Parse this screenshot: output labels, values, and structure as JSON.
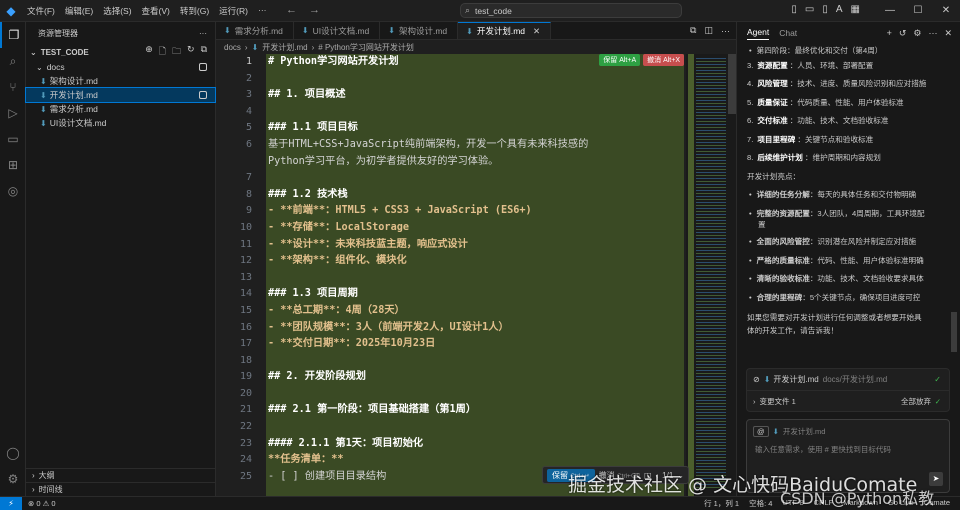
{
  "menu": [
    "文件(F)",
    "编辑(E)",
    "选择(S)",
    "查看(V)",
    "转到(G)",
    "运行(R)"
  ],
  "search": {
    "value": "test_code"
  },
  "sidebar": {
    "title": "资源管理器",
    "root": "TEST_CODE",
    "folder": "docs",
    "files": [
      "架构设计.md",
      "开发计划.md",
      "需求分析.md",
      "UI设计文档.md"
    ],
    "bottom": [
      "大纲",
      "时间线"
    ]
  },
  "tabs": [
    "需求分析.md",
    "UI设计文档.md",
    "架构设计.md",
    "开发计划.md"
  ],
  "breadcrumb": [
    "docs",
    "开发计划.md",
    "# Python学习网站开发计划"
  ],
  "keep_buttons": {
    "keep": "保留 Alt+A",
    "undo": "撤消 Alt+X"
  },
  "editor": {
    "line_numbers": [
      "1",
      "2",
      "3",
      "4",
      "5",
      "6",
      "",
      "7",
      "8",
      "9",
      "10",
      "11",
      "12",
      "13",
      "14",
      "15",
      "16",
      "17",
      "18",
      "19",
      "20",
      "21",
      "22",
      "23",
      "24",
      "25"
    ],
    "lines": [
      {
        "t": "# Python学习网站开发计划",
        "k": "h"
      },
      {
        "t": "",
        "k": "t"
      },
      {
        "t": "## 1. 项目概述",
        "k": "h"
      },
      {
        "t": "",
        "k": "t"
      },
      {
        "t": "### 1.1 项目目标",
        "k": "h"
      },
      {
        "t": "基于HTML+CSS+JavaScript纯前端架构，开发一个具有未来科技感的",
        "k": "t"
      },
      {
        "t": "Python学习平台，为初学者提供友好的学习体验。",
        "k": "t"
      },
      {
        "t": "",
        "k": "t"
      },
      {
        "t": "### 1.2 技术栈",
        "k": "h"
      },
      {
        "t": "- **前端**：HTML5 + CSS3 + JavaScript (ES6+)",
        "k": "b"
      },
      {
        "t": "- **存储**：LocalStorage",
        "k": "b"
      },
      {
        "t": "- **设计**：未来科技蓝主题，响应式设计",
        "k": "b"
      },
      {
        "t": "- **架构**：组件化、模块化",
        "k": "b"
      },
      {
        "t": "",
        "k": "t"
      },
      {
        "t": "### 1.3 项目周期",
        "k": "h"
      },
      {
        "t": "- **总工期**：4周（28天）",
        "k": "b"
      },
      {
        "t": "- **团队规模**：3人（前端开发2人，UI设计1人）",
        "k": "b"
      },
      {
        "t": "- **交付日期**：2025年10月23日",
        "k": "b"
      },
      {
        "t": "",
        "k": "t"
      },
      {
        "t": "## 2. 开发阶段规划",
        "k": "h"
      },
      {
        "t": "",
        "k": "t"
      },
      {
        "t": "### 2.1 第一阶段：项目基础搭建（第1周）",
        "k": "h"
      },
      {
        "t": "",
        "k": "t"
      },
      {
        "t": "#### 2.1.1 第1天：项目初始化",
        "k": "h"
      },
      {
        "t": "**任务清单：**",
        "k": "b"
      },
      {
        "t": "- [ ] 创建项目目录结构",
        "k": "t"
      }
    ]
  },
  "diffbar": {
    "keep": "保留",
    "keep_hint": "Ctrl+↵",
    "undo": "撤消",
    "undo_hint": "Ctrl+⌫",
    "page": "1/1"
  },
  "chat": {
    "tabs": [
      "Agent",
      "Chat"
    ],
    "top_sub": "第四阶段：最终优化和交付（第4周）",
    "numbered": [
      {
        "n": "3.",
        "b": "资源配置",
        "r": "：人员、环境、部署配置"
      },
      {
        "n": "4.",
        "b": "风险管理",
        "r": "：技术、进度、质量风险识别和应对措施"
      },
      {
        "n": "5.",
        "b": "质量保证",
        "r": "：代码质量、性能、用户体验标准"
      },
      {
        "n": "6.",
        "b": "交付标准",
        "r": "：功能、技术、文档验收标准"
      },
      {
        "n": "7.",
        "b": "项目里程碑",
        "r": "：关键节点和验收标准"
      },
      {
        "n": "8.",
        "b": "后续维护计划",
        "r": "：维护周期和内容规划"
      }
    ],
    "highlights_title": "开发计划亮点：",
    "highlights": [
      {
        "b": "详细的任务分解",
        "r": "：每天的具体任务和交付物明确"
      },
      {
        "b": "完整的资源配置",
        "r": "：3人团队，4周周期，工具环境配",
        "wrap": "置"
      },
      {
        "b": "全面的风险管控",
        "r": "：识别潜在风险并制定应对措施"
      },
      {
        "b": "严格的质量标准",
        "r": "：代码、性能、用户体验标准明确"
      },
      {
        "b": "清晰的验收标准",
        "r": "：功能、技术、文档验收要求具体"
      },
      {
        "b": "合理的里程碑",
        "r": "：5个关键节点，确保项目进度可控"
      }
    ],
    "closing1": "如果您需要对开发计划进行任何调整或者想要开始具",
    "closing2": "体的开发工作，请告诉我！",
    "file_card": {
      "name": "开发计划.md",
      "path": "docs/开发计划.md",
      "changes": "变更文件 1",
      "reject_all": "全部放弃"
    },
    "input": {
      "chip": "开发计划.md",
      "placeholder": "输入任意需求，使用 # 更快找到目标代码"
    }
  },
  "status": {
    "left": "⊗ 0 ⚠ 0",
    "position": "行 1，列 1",
    "spaces": "空格: 4",
    "encoding": "UTF-8",
    "eol": "CRLF",
    "lang": "Markdown",
    "golive": "Go Live",
    "comate": "Comate"
  },
  "watermark": "掘金技术社区 @ 文心快码BaiduComate",
  "watermark2": "CSDN @Python私教"
}
